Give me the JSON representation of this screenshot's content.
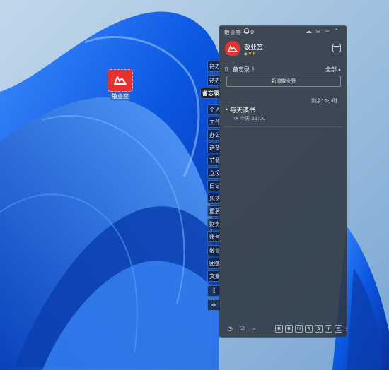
{
  "desktop": {
    "icon_label": "敬业签"
  },
  "side_tabs": [
    {
      "label": "待办"
    },
    {
      "label": "待办"
    },
    {
      "label": "备忘录",
      "active": true
    },
    {
      "label": "个人"
    },
    {
      "label": "工作"
    },
    {
      "label": "办公"
    },
    {
      "label": "送货"
    },
    {
      "label": "节假"
    },
    {
      "label": "立项"
    },
    {
      "label": "日记"
    },
    {
      "label": "乐迹"
    },
    {
      "label": "重要"
    },
    {
      "label": "财务"
    },
    {
      "label": "账号"
    },
    {
      "label": "敬业"
    },
    {
      "label": "团签"
    },
    {
      "label": "文案"
    },
    {
      "label": "⋮"
    },
    {
      "label": "+"
    }
  ],
  "panel": {
    "title": "敬业签",
    "notification_count": "0",
    "user_name": "敬业签",
    "vip_label": "VIP",
    "section_label": "备忘录",
    "section_count": "1",
    "filter_label": "全部",
    "new_note_label": "新增敬业签",
    "remaining_label": "剩余12小时",
    "task": {
      "name": "每天读书",
      "time": "今天 21:00"
    },
    "format_buttons": [
      "B",
      "B",
      "U",
      "S",
      "A",
      "I",
      "三"
    ]
  },
  "colors": {
    "panel_bg": "#2c343e",
    "brand_red": "#e8312f",
    "vip_gold": "#f2c94c"
  }
}
